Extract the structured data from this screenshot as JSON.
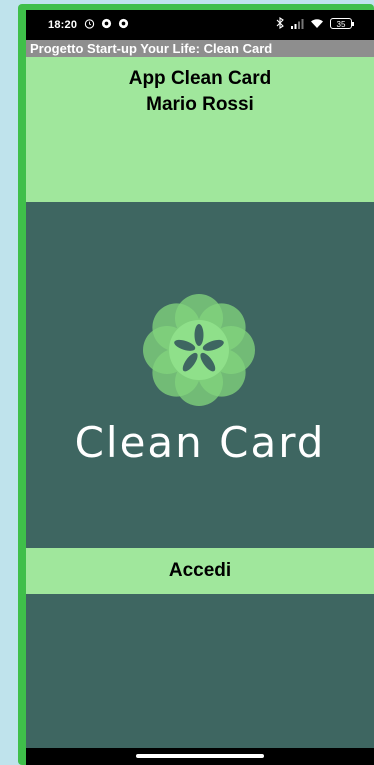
{
  "status_bar": {
    "time": "18:20",
    "battery": "35",
    "icons": [
      "alarm-icon",
      "notification-icon",
      "notification-icon",
      "bluetooth-icon",
      "signal-icon",
      "wifi-icon",
      "battery-icon"
    ]
  },
  "title_bar": {
    "title": "Progetto Start-up Your Life: Clean Card"
  },
  "header": {
    "app_name": "App Clean Card",
    "user_name": "Mario Rossi"
  },
  "logo": {
    "icon": "flower-logo-icon",
    "brand": "Clean Card"
  },
  "actions": {
    "login_label": "Accedi"
  },
  "colors": {
    "accent_green": "#a0e79c",
    "background_dark": "#3e6661",
    "frame_green": "#3fbf4a",
    "title_bar_gray": "#8e8e8e"
  }
}
